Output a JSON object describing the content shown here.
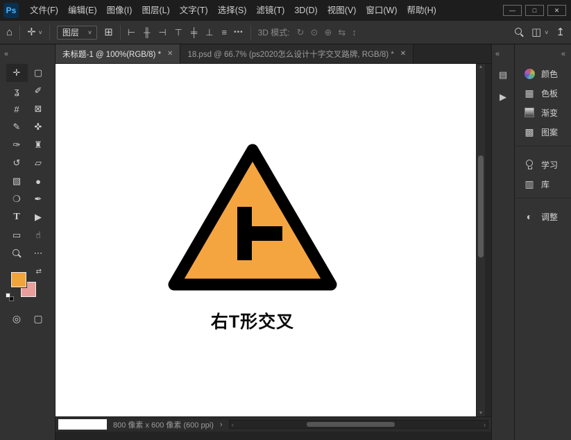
{
  "titlebar": {
    "logo": "Ps",
    "menus": [
      {
        "label": "文件(F)"
      },
      {
        "label": "编辑(E)"
      },
      {
        "label": "图像(I)"
      },
      {
        "label": "图层(L)"
      },
      {
        "label": "文字(T)"
      },
      {
        "label": "选择(S)"
      },
      {
        "label": "滤镜(T)"
      },
      {
        "label": "3D(D)"
      },
      {
        "label": "视图(V)"
      },
      {
        "label": "窗口(W)"
      },
      {
        "label": "帮助(H)"
      }
    ],
    "window_controls": {
      "minimize": "—",
      "maximize": "□",
      "close": "✕"
    }
  },
  "options_bar": {
    "home_icon": "⌂",
    "tool_icon": "✛",
    "tool_caret": "˅",
    "auto_select_value": "图层",
    "dropdown_caret": "˅",
    "transform_icon": "⊞",
    "align_icons": [
      "⊢",
      "╫",
      "⊣",
      "⊤",
      "╪",
      "⊥",
      "≡"
    ],
    "more_icon": "•••",
    "mode_label": "3D 模式:",
    "mode_icons": [
      "↻",
      "⊙",
      "⊕",
      "⇆",
      "↕"
    ],
    "workspace_icon": "◫",
    "workspace_caret": "˅",
    "share_icon": "↥"
  },
  "tabbar": {
    "tabs": [
      {
        "title": "未标题-1 @ 100%(RGB/8) *",
        "close": "✕"
      },
      {
        "title": "18.psd @ 66.7% (ps2020怎么设计十字交叉路牌, RGB/8) *",
        "close": "✕"
      }
    ]
  },
  "toolbar": {
    "collapse_icon": "«",
    "tools": [
      {
        "name": "move-tool",
        "glyph": "✛"
      },
      {
        "name": "rectangular-marquee-tool",
        "glyph": "▢"
      },
      {
        "name": "lasso-tool",
        "glyph": "ʓ"
      },
      {
        "name": "object-selection-tool",
        "glyph": "✐"
      },
      {
        "name": "crop-tool",
        "glyph": "#"
      },
      {
        "name": "frame-tool",
        "glyph": "⊠"
      },
      {
        "name": "eyedropper-tool",
        "glyph": "✎"
      },
      {
        "name": "spot-healing-brush-tool",
        "glyph": "✜"
      },
      {
        "name": "brush-tool",
        "glyph": "✑"
      },
      {
        "name": "clone-stamp-tool",
        "glyph": "♜"
      },
      {
        "name": "history-brush-tool",
        "glyph": "↺"
      },
      {
        "name": "eraser-tool",
        "glyph": "▱"
      },
      {
        "name": "gradient-tool",
        "glyph": "▧"
      },
      {
        "name": "blur-tool",
        "glyph": "●"
      },
      {
        "name": "dodge-tool",
        "glyph": "❍"
      },
      {
        "name": "pen-tool",
        "glyph": "✒"
      },
      {
        "name": "type-tool",
        "glyph": "T"
      },
      {
        "name": "path-selection-tool",
        "glyph": "▶"
      },
      {
        "name": "rectangle-tool",
        "glyph": "▭"
      },
      {
        "name": "hand-tool",
        "glyph": "☝"
      },
      {
        "name": "zoom-tool",
        "glyph": ""
      },
      {
        "name": "edit-toolbar",
        "glyph": "⋯"
      }
    ],
    "swap_icon": "⇄",
    "foreground_color": "#F1A43B",
    "background_color": "#E89F9C",
    "quick_mask_icon": "◎",
    "screen_mode_icon": "▢"
  },
  "canvas": {
    "sign_fill": "#F5A540",
    "sign_stroke": "#000000",
    "label": "右T形交叉"
  },
  "status_bar": {
    "zoom_value": "",
    "dimensions": "800 像素 x 600 像素 (600 ppi)",
    "menu_arrow": "›",
    "scroll_left": "‹",
    "scroll_right": "›"
  },
  "right_strip": {
    "collapse_icon": "«",
    "icons": [
      {
        "name": "properties-panel-icon",
        "glyph": "▤"
      },
      {
        "name": "play-panel-icon",
        "glyph": "▶"
      }
    ]
  },
  "right_panel": {
    "collapse_icon": "«",
    "items": [
      {
        "label": "颜色"
      },
      {
        "label": "色板"
      },
      {
        "label": "渐变"
      },
      {
        "label": "图案"
      },
      {
        "label": "学习"
      },
      {
        "label": "库"
      },
      {
        "label": "调整"
      }
    ]
  }
}
